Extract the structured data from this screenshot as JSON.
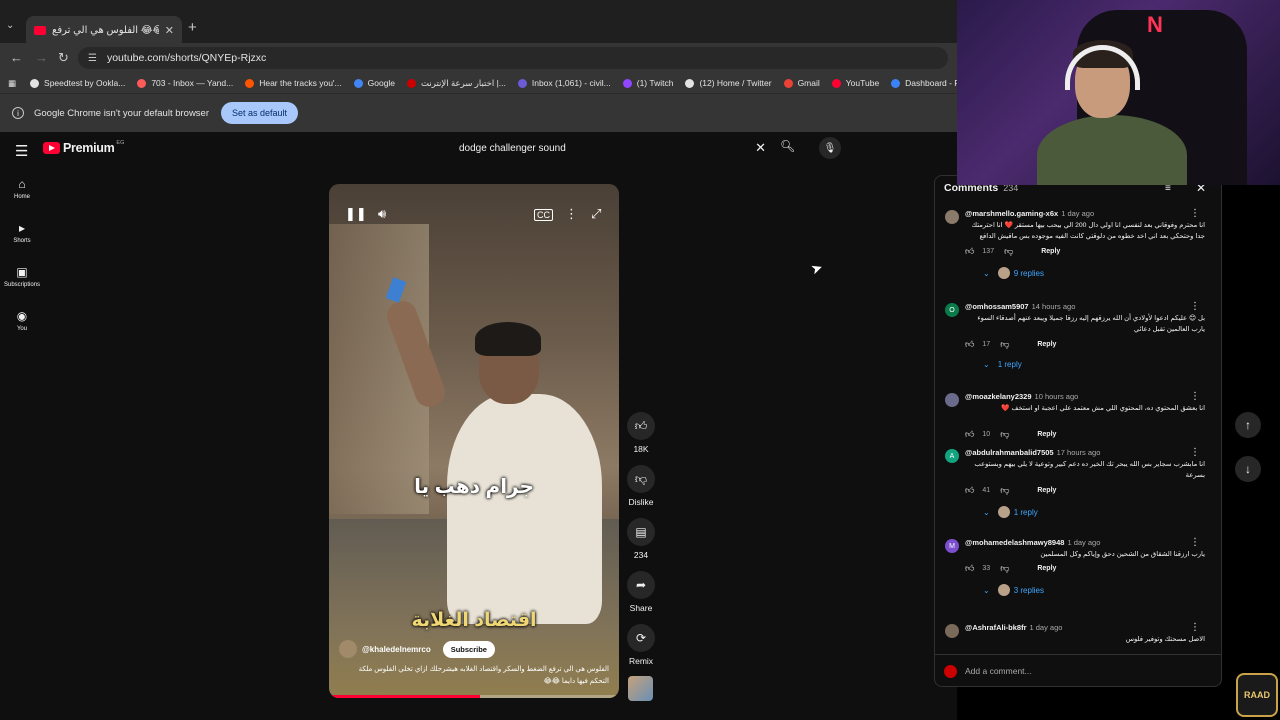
{
  "browser": {
    "tab_title": "الفلوس هي الي ترفع 😂😂",
    "url": "youtube.com/shorts/QNYEp-Rjzxc",
    "bookmarks": [
      {
        "label": "Speedtest by Ookla...",
        "color": "#e3e3e3"
      },
      {
        "label": "703 - Inbox — Yand...",
        "color": "#ff5a5a"
      },
      {
        "label": "Hear the tracks you'...",
        "color": "#ff5500"
      },
      {
        "label": "Google",
        "color": "#4285f4"
      },
      {
        "label": "اختبار سرعة الإنترنت |...",
        "color": "#c00"
      },
      {
        "label": "Inbox (1,061) - civil...",
        "color": "#6b5bd6"
      },
      {
        "label": "(1) Twitch",
        "color": "#9146ff"
      },
      {
        "label": "(12) Home / Twitter",
        "color": "#e3e3e3"
      },
      {
        "label": "Gmail",
        "color": "#ea4335"
      },
      {
        "label": "YouTube",
        "color": "#ff0033"
      },
      {
        "label": "Dashboard - Restre...",
        "color": "#3b82f6"
      }
    ],
    "infobar_text": "Google Chrome isn't your default browser",
    "set_default_label": "Set as default"
  },
  "youtube": {
    "logo_text": "Premium",
    "logo_country": "EG",
    "search_value": "dodge challenger sound",
    "guide": [
      {
        "label": "Home",
        "icon": "home-icon",
        "glyph": "⌂"
      },
      {
        "label": "Shorts",
        "icon": "shorts-icon",
        "glyph": "▸"
      },
      {
        "label": "Subscriptions",
        "icon": "subscriptions-icon",
        "glyph": "▣"
      },
      {
        "label": "You",
        "icon": "you-icon",
        "glyph": "◉"
      }
    ],
    "video": {
      "caption_top": "جرام دهب يا",
      "caption_bottom": "اقتصاد الغلابة",
      "channel": "@khaledelnemrco",
      "subscribe_label": "Subscribe",
      "description": "الفلوس هي الي ترفع الضغط والسكر واقتصاد الغلابه هيشرحلك ازاي تخلي الفلوس ملكة التحكم فيها دايما 😂😂",
      "progress": 0.52
    },
    "actions": {
      "likes": "18K",
      "dislike_label": "Dislike",
      "comments": "234",
      "share_label": "Share",
      "remix_label": "Remix"
    }
  },
  "comments_panel": {
    "title": "Comments",
    "count": "234",
    "reply_label": "Reply",
    "add_placeholder": "Add a comment...",
    "items": [
      {
        "user": "@marshmello.gaming-x6x",
        "time": "1 day ago",
        "text": "انا محترم وفوقاني بعد لنفسي انا اولي دال 200 الي بيحب بيها مستقر ❤️ انا احترمتك جدا وحتحكي بعد اني اخد خطوه من دلوقتي كانت الفيه موجوده بس ماقيش الدافع",
        "likes": "137",
        "replies": "9 replies",
        "avatar_color": "#8a7a6a",
        "avatar_letter": ""
      },
      {
        "user": "@omhossam5907",
        "time": "14 hours ago",
        "text": "بل 😊 عليكم ادعوا لأولادي أن الله يرزقهم إليه رزقا جميلا ويبعد عنهم أصدقاء السوء يارب العالمين تقبل دعائي",
        "likes": "17",
        "replies": "1 reply",
        "avatar_color": "#0b7a4a",
        "avatar_letter": "O"
      },
      {
        "user": "@moazkelany2329",
        "time": "10 hours ago",
        "text": "انا بعشق المحتوي ده، المحتوي اللي مش معتمد علي اعجبة او استخف ❤️",
        "likes": "10",
        "replies": "",
        "avatar_color": "#6a6a8a",
        "avatar_letter": ""
      },
      {
        "user": "@abdulrahmanbalid7505",
        "time": "17 hours ago",
        "text": "انا مابشرب سجاير بس الله يبحر تك الخير ده دعم كبير وتوعية لا يلي بيهم وبستوعب بسرعة",
        "likes": "41",
        "replies": "1 reply",
        "avatar_color": "#12a37f",
        "avatar_letter": "A"
      },
      {
        "user": "@mohamedelashmawy8948",
        "time": "1 day ago",
        "text": "يارب ارزقنا الشقاق من الشحين دحق وإياكم وكل المسلمين",
        "likes": "33",
        "replies": "3 replies",
        "avatar_color": "#7b4fcf",
        "avatar_letter": "M"
      },
      {
        "user": "@AshrafAli-bk8fr",
        "time": "1 day ago",
        "text": "الاصل مسحتك وتوفير فلوس",
        "likes": "",
        "replies": "",
        "avatar_color": "#7a6a5a",
        "avatar_letter": ""
      }
    ]
  },
  "overlay": {
    "brand_text": "RAAD"
  }
}
